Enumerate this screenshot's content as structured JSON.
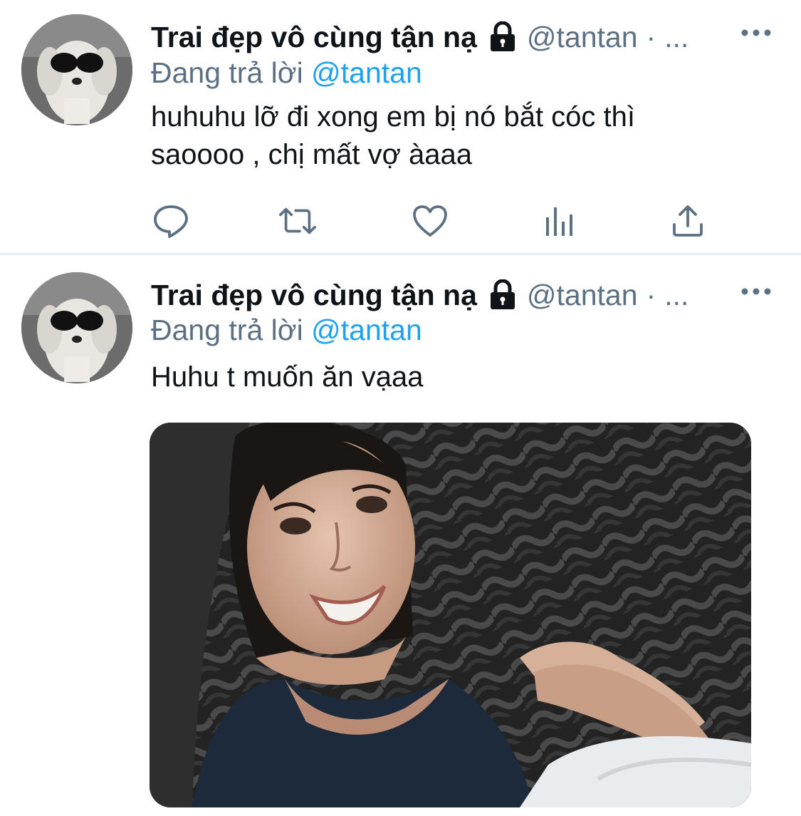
{
  "tweets": [
    {
      "display_name": "Trai đẹp vô cùng tận nạ",
      "handle": "@tantan",
      "separator": "·",
      "truncation": "...",
      "reply_prefix": "Đang trả lời",
      "reply_mention": "@tantan",
      "text_line1": "huhuhu lỡ đi xong em bị nó bắt cóc thì",
      "text_line2": "saoooo , chị mất vợ àaaa",
      "icons": [
        "reply-icon",
        "retweet-icon",
        "like-icon",
        "analytics-icon",
        "share-icon"
      ]
    },
    {
      "display_name": "Trai đẹp vô cùng tận nạ",
      "handle": "@tantan",
      "separator": "·",
      "truncation": "...",
      "reply_prefix": "Đang trả lời",
      "reply_mention": "@tantan",
      "text_line1": "Huhu t muốn ăn vạaa",
      "media": "photo"
    }
  ],
  "colors": {
    "text": "#0f1419",
    "secondary": "#5b7083",
    "link": "#1da1f2",
    "divider": "#e6ecf0"
  }
}
